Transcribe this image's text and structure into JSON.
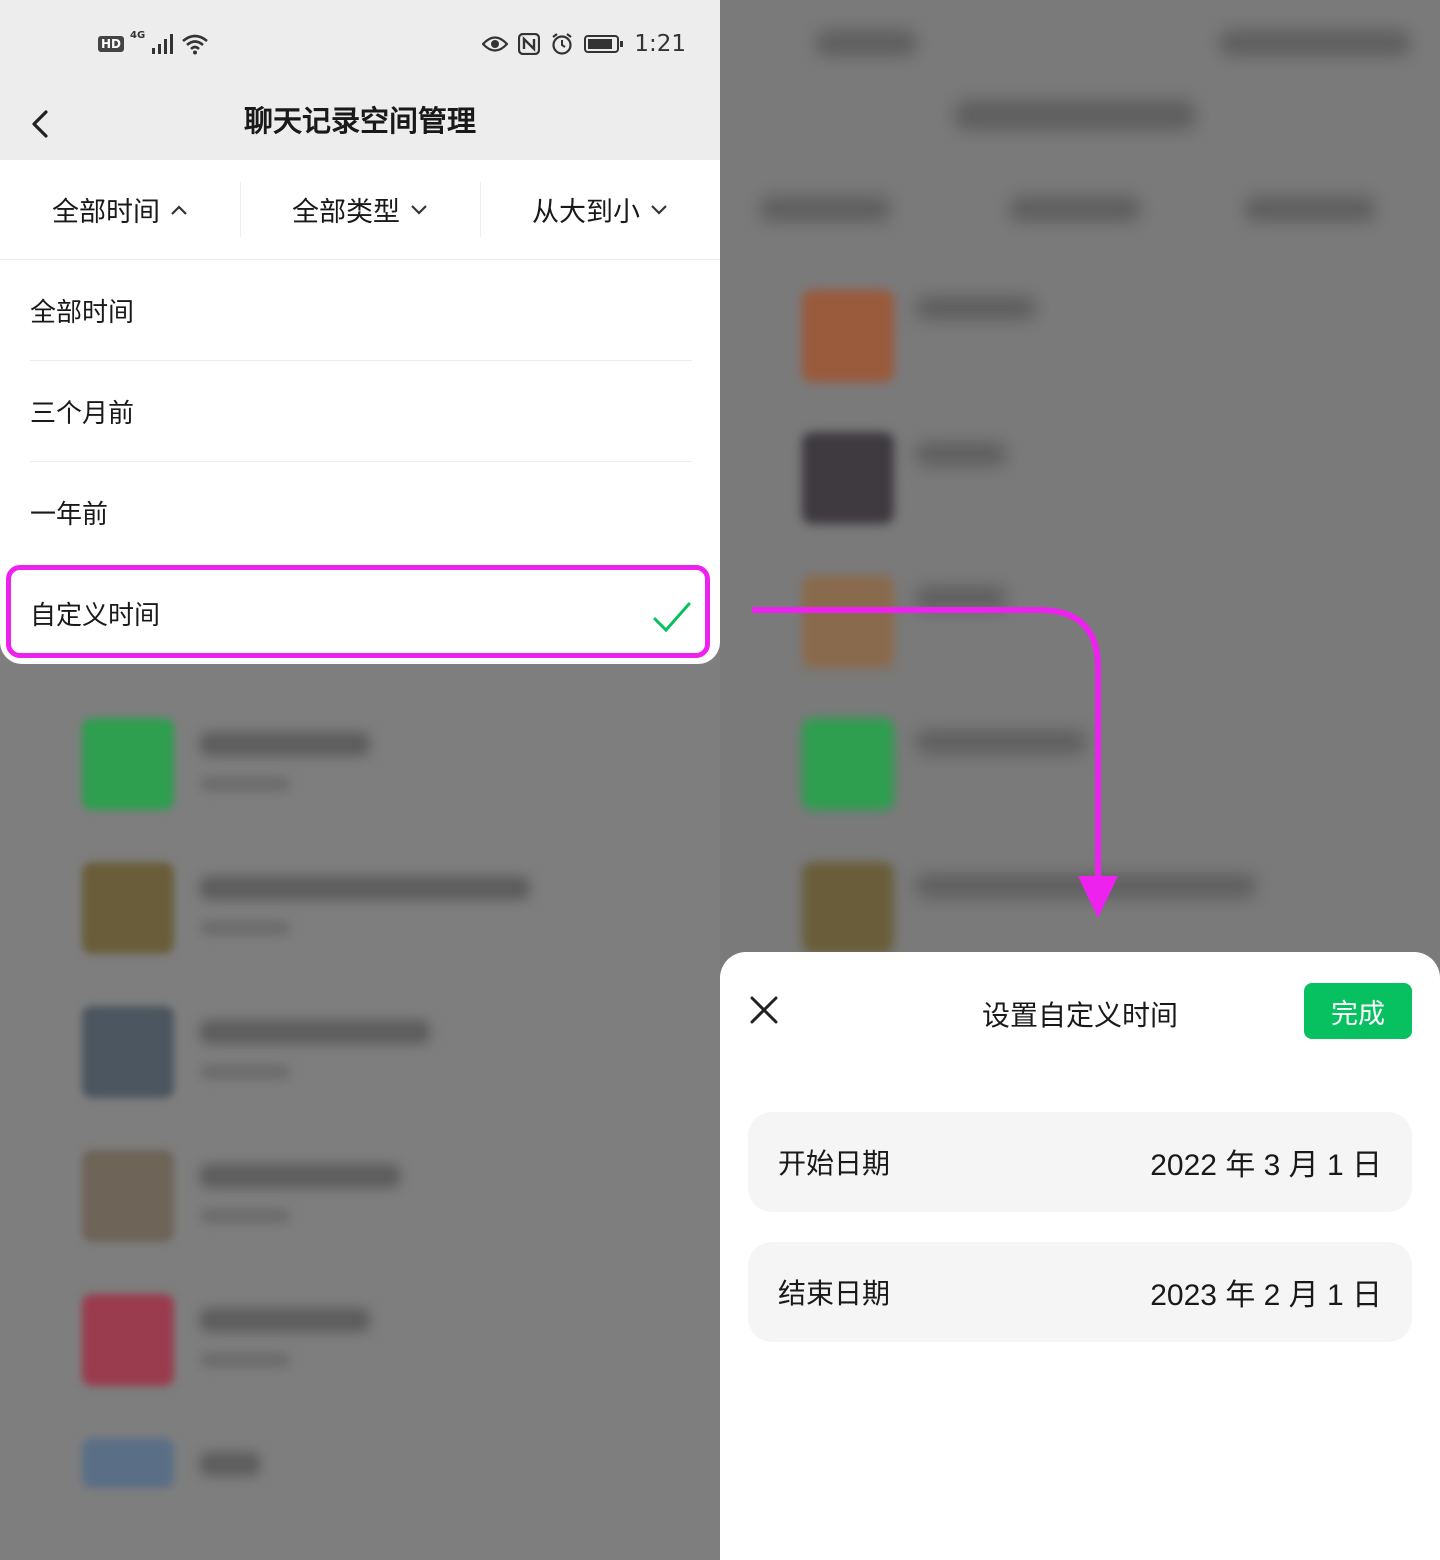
{
  "left_screen": {
    "status_bar": {
      "hd": "HD",
      "network": "4G",
      "time": "1:21"
    },
    "title": "聊天记录空间管理",
    "filters": [
      {
        "label": "全部时间",
        "state": "expanded"
      },
      {
        "label": "全部类型",
        "state": "collapsed"
      },
      {
        "label": "从大到小",
        "state": "collapsed"
      }
    ],
    "dropdown_options": [
      {
        "label": "全部时间"
      },
      {
        "label": "三个月前"
      },
      {
        "label": "一年前"
      },
      {
        "label": "自定义时间",
        "selected": true
      }
    ],
    "accent_check_color": "#07c160"
  },
  "right_screen": {
    "sheet": {
      "title": "设置自定义时间",
      "done_label": "完成",
      "start_label": "开始日期",
      "start_value": "2022 年 3 月 1 日",
      "end_label": "结束日期",
      "end_value": "2023 年 2 月 1 日"
    },
    "accent_color": "#07c160"
  },
  "annotation": {
    "highlight_color": "#ee22ee",
    "arrow_color": "#ee22ee"
  }
}
